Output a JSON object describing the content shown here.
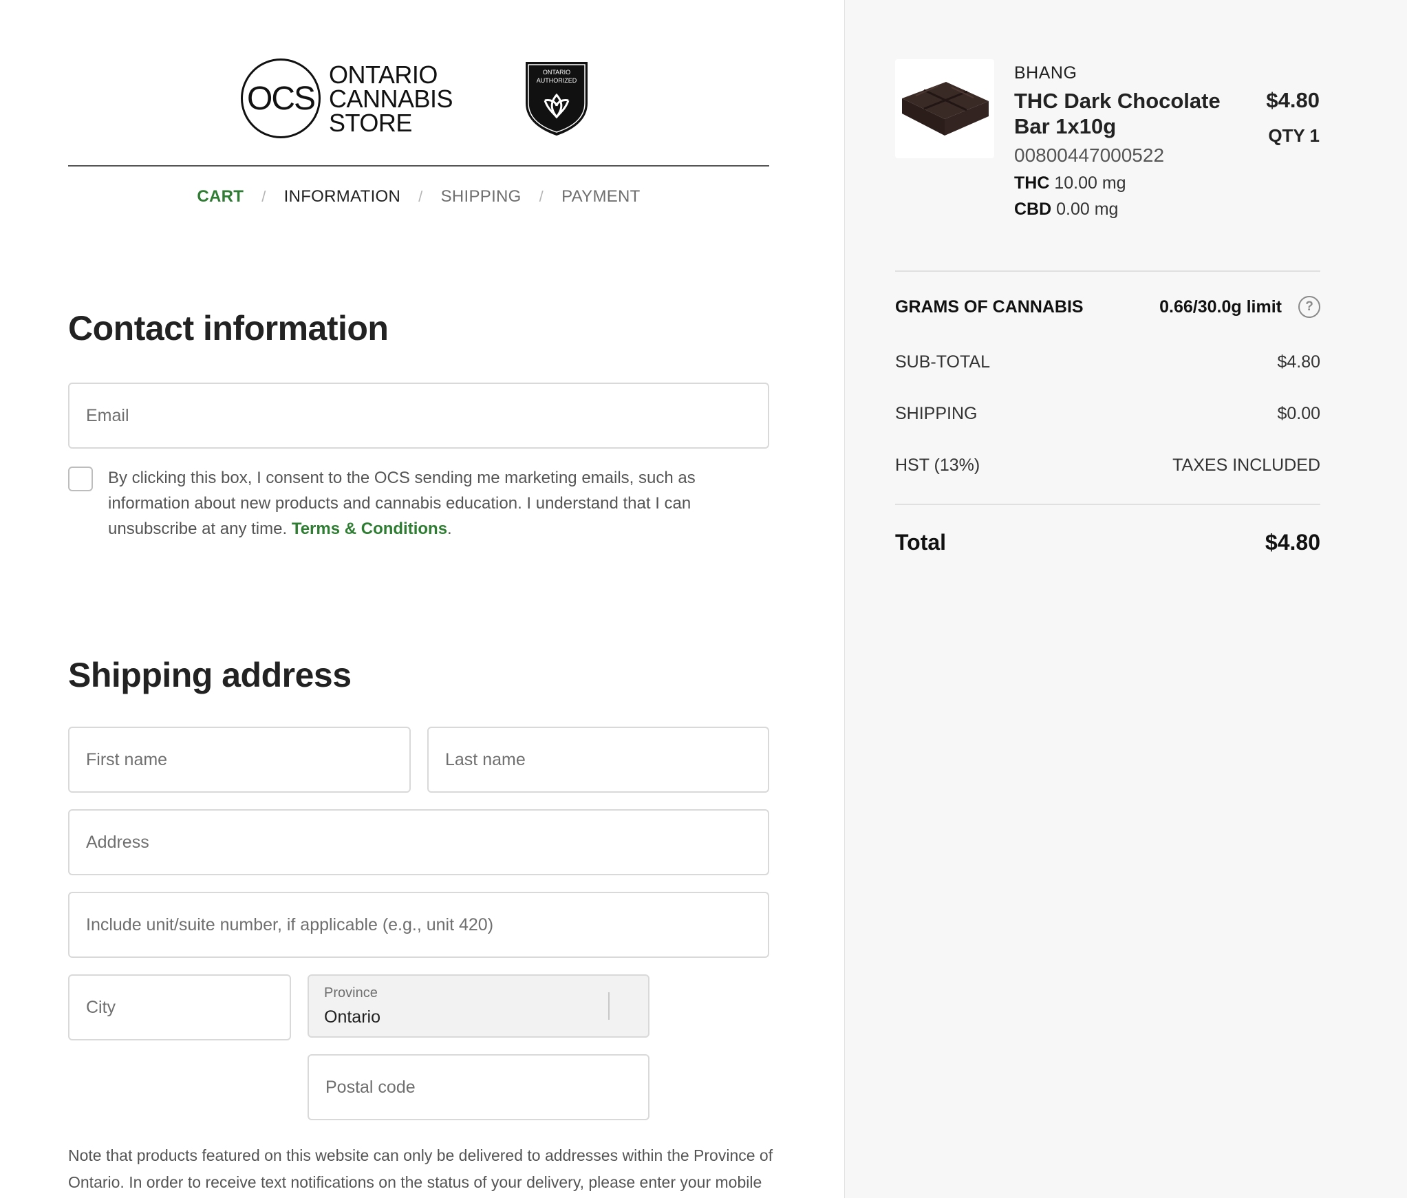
{
  "header": {
    "logo_mark": "OCS",
    "logo_words": [
      "ONTARIO",
      "CANNABIS",
      "STORE"
    ],
    "badge_line1": "ONTARIO",
    "badge_line2": "AUTHORIZED"
  },
  "breadcrumb": {
    "cart": "CART",
    "information": "INFORMATION",
    "shipping": "SHIPPING",
    "payment": "PAYMENT",
    "separator": "/"
  },
  "contact": {
    "title": "Contact information",
    "email_placeholder": "Email",
    "consent_text": "By clicking this box, I consent to the OCS sending me marketing emails, such as information about new products and cannabis education. I understand that I can unsubscribe at any time. ",
    "terms_link": "Terms & Conditions",
    "terms_suffix": "."
  },
  "shipping": {
    "title": "Shipping address",
    "first_name_placeholder": "First name",
    "last_name_placeholder": "Last name",
    "address_placeholder": "Address",
    "unit_placeholder": "Include unit/suite number, if applicable (e.g., unit 420)",
    "city_placeholder": "City",
    "province_label": "Province",
    "province_value": "Ontario",
    "postal_placeholder": "Postal code",
    "note": "Note that products featured on this website can only be delivered to addresses within the Province of Ontario. In order to receive text notifications on the status of your delivery, please enter your mobile"
  },
  "summary": {
    "product": {
      "brand": "BHANG",
      "name": "THC Dark Chocolate Bar 1x10g",
      "sku": "00800447000522",
      "thc_label": "THC",
      "thc_value": "10.00 mg",
      "cbd_label": "CBD",
      "cbd_value": "0.00 mg",
      "price": "$4.80",
      "qty": "QTY 1"
    },
    "grams_label": "GRAMS OF CANNABIS",
    "grams_value": "0.66/30.0g limit",
    "help_icon_glyph": "?",
    "subtotal_label": "SUB-TOTAL",
    "subtotal_value": "$4.80",
    "shipping_label": "SHIPPING",
    "shipping_value": "$0.00",
    "hst_label": "HST (13%)",
    "hst_value": "TAXES INCLUDED",
    "total_label": "Total",
    "total_value": "$4.80"
  },
  "colors": {
    "accent_green": "#2e7d32",
    "sidebar_bg": "#f7f7f7"
  },
  "icons": [
    "ocs-logo",
    "ontario-authorized-badge",
    "trillium-icon",
    "help-icon",
    "checkbox"
  ]
}
